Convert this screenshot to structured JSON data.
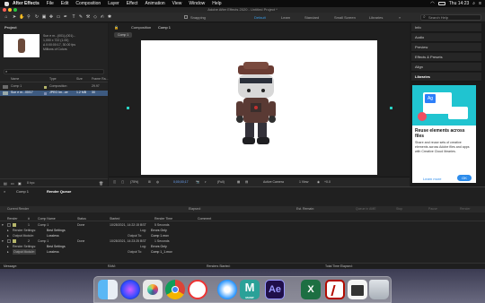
{
  "menubar": {
    "app": "After Effects",
    "items": [
      "File",
      "Edit",
      "Composition",
      "Layer",
      "Effect",
      "Animation",
      "View",
      "Window",
      "Help"
    ],
    "clock": "Thu 14:23"
  },
  "window_title": "Adobe After Effects 2020 - Untitled Project *",
  "toolbar": {
    "snapping": "Snapping",
    "workspaces": [
      "Default",
      "Learn",
      "Standard",
      "Small Screen",
      "Libraries"
    ],
    "active_workspace": "Default",
    "search_placeholder": "Search Help"
  },
  "project": {
    "tab": "Project",
    "info_line1": "Sun e m...(001)-(001)...",
    "info_line2": "1,000 x 722 (1.00)",
    "info_line3": "Δ 0:00:00:17, 30.00 fps",
    "info_line4": "Millions of Colors",
    "search_placeholder": "",
    "columns": [
      "Name",
      "Type",
      "Size",
      "Frame Ra..."
    ],
    "items": [
      {
        "name": "Comp 1",
        "type": "Composition",
        "size": "",
        "fps": "29.97",
        "color": "#b5b56a"
      },
      {
        "name": "Sun e m...00/17",
        "type": "JPEG Im...ce",
        "size": "1.2 MB",
        "fps": "30",
        "color": "#7f8fb3"
      }
    ],
    "footer": "8 bpc"
  },
  "composition": {
    "tab": "Composition",
    "comp_name": "Comp 1",
    "sub_tab": "Comp 1",
    "zoom": "(75%)",
    "timecode": "0;00;00;17",
    "resolution": "(Full)",
    "camera": "Active Camera",
    "view": "1 View",
    "offset": "+0.0"
  },
  "right_panel": {
    "items": [
      "Info",
      "Audio",
      "Preview",
      "Effects & Presets",
      "Align",
      "Libraries"
    ],
    "libraries_ad": {
      "title": "Reuse elements across files",
      "body": "Share and reuse sets of creative elements across Adobe files and apps with Creative Cloud libraries.",
      "cta": "Learn more",
      "ok": "OK"
    }
  },
  "render_queue": {
    "tabs": [
      "Comp 1",
      "Render Queue"
    ],
    "current_render_label": "Current Render",
    "elapsed_label": "Elapsed:",
    "est_remain_label": "Est. Remain:",
    "buttons": [
      "Queue in AME",
      "Stop",
      "Pause",
      "Render"
    ],
    "columns": [
      "Render",
      "#",
      "Comp Name",
      "Status",
      "Started",
      "Render Time",
      "Comment"
    ],
    "items": [
      {
        "index": "1",
        "comp": "Comp 1",
        "status": "Done",
        "started": "10/28/2021, 14:22:15 BST",
        "time": "5 Seconds",
        "render_settings": "Best Settings",
        "output_module": "Lossless",
        "log": "Errors Only",
        "output_to": "Comp 1.mov"
      },
      {
        "index": "2",
        "comp": "Comp 1",
        "status": "Done",
        "started": "10/28/2021, 14:23:25 BST",
        "time": "1 Seconds",
        "render_settings": "Best Settings",
        "output_module": "Lossless",
        "log": "Errors Only",
        "output_to": "Comp 1_1.mov"
      }
    ],
    "labels": {
      "render_settings": "Render Settings:",
      "output_module": "Output Module:",
      "log": "Log:",
      "output_to": "Output To:"
    }
  },
  "statusbar": {
    "message": "Message:",
    "ram": "RAM:",
    "renders_started": "Renders Started:",
    "total_time": "Total Time Elapsed:"
  },
  "dock": {
    "icons": [
      "finder-icon",
      "siri-icon",
      "photos-icon",
      "chrome-icon",
      "news-icon",
      "safari-icon",
      "mamp-icon",
      "after-effects-icon",
      "excel-icon",
      "acrobat-icon",
      "preview-icon",
      "trash-icon"
    ],
    "mamp_label": "MAMP",
    "ae_label": "Ae"
  },
  "colors": {
    "accent": "#2d8ceb",
    "ae_purple": "#1f0f4a",
    "ae_text": "#9999ff"
  }
}
